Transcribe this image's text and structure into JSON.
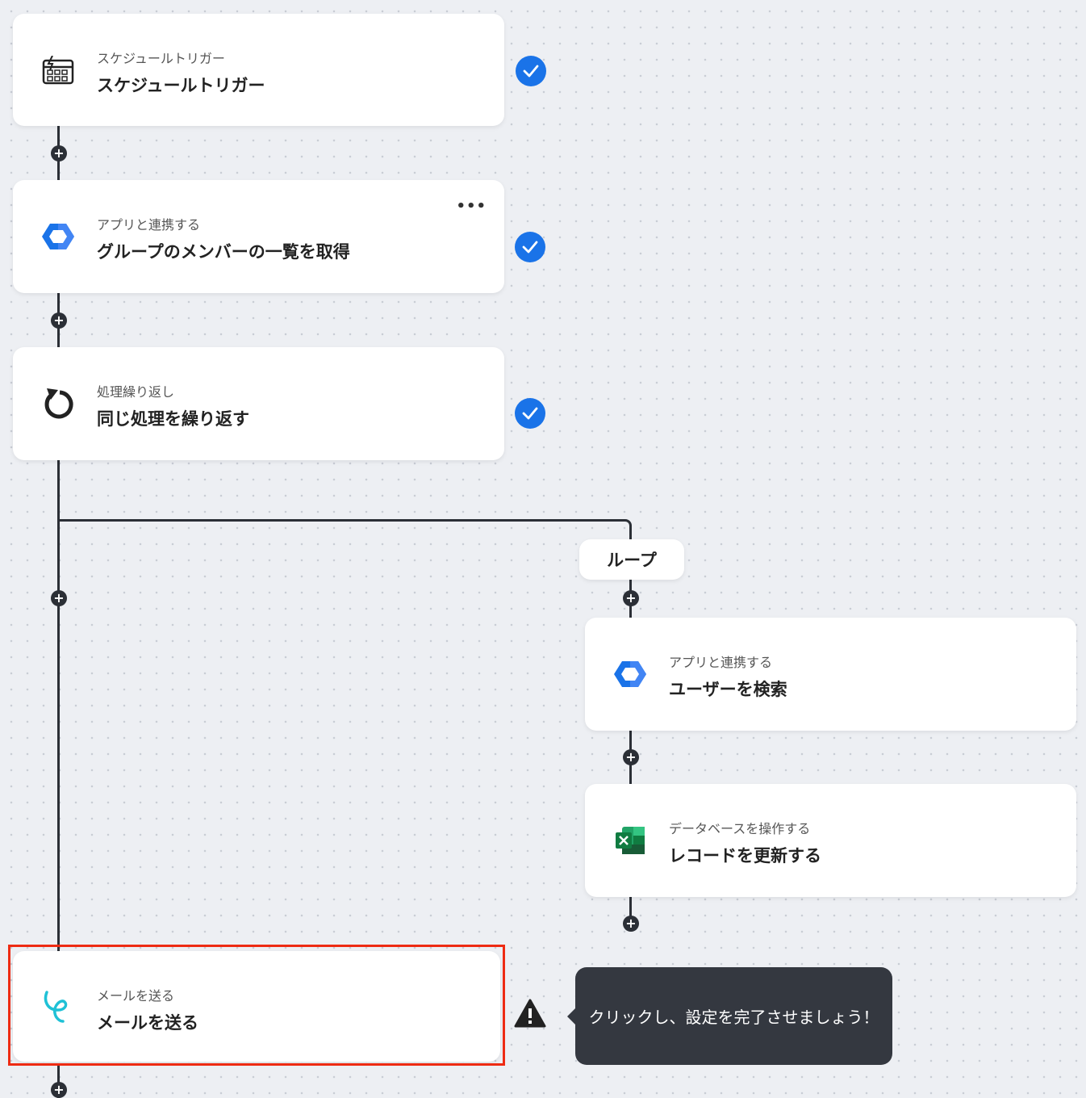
{
  "steps": [
    {
      "subtitle": "スケジュールトリガー",
      "title": "スケジュールトリガー",
      "icon": "calendar-lightning-icon",
      "status": "complete"
    },
    {
      "subtitle": "アプリと連携する",
      "title": "グループのメンバーの一覧を取得",
      "icon": "google-workspace-icon",
      "status": "complete"
    },
    {
      "subtitle": "処理繰り返し",
      "title": "同じ処理を繰り返す",
      "icon": "loop-arrow-icon",
      "status": "complete"
    }
  ],
  "loop": {
    "label": "ループ",
    "steps": [
      {
        "subtitle": "アプリと連携する",
        "title": "ユーザーを検索",
        "icon": "google-workspace-icon"
      },
      {
        "subtitle": "データベースを操作する",
        "title": "レコードを更新する",
        "icon": "excel-icon"
      }
    ]
  },
  "final_step": {
    "subtitle": "メールを送る",
    "title": "メールを送る",
    "icon": "mail-brand-icon",
    "status": "warning"
  },
  "tooltip": {
    "text": "クリックし、設定を完了させましょう！"
  },
  "menu": {
    "dots": "•••"
  },
  "plus_symbol": "+",
  "colors": {
    "check": "#1a73e8",
    "highlight": "#ee2b13",
    "tooltip_bg": "#343840",
    "line": "#2b2f36"
  }
}
